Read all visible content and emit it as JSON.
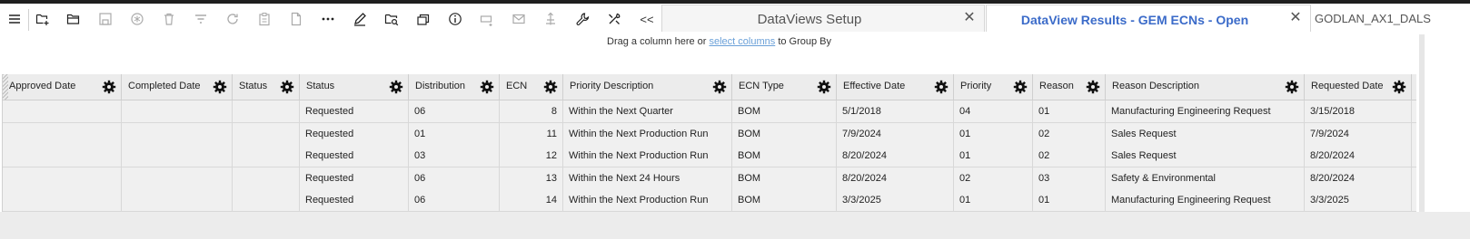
{
  "toolbar": {
    "icons": [
      "menu-icon",
      "add-folder-icon",
      "open-folder-icon",
      "save-icon",
      "settings-asterisk-icon",
      "delete-icon",
      "filter-icon",
      "refresh-icon",
      "clipboard-icon",
      "document-icon",
      "more-icon",
      "edit-icon",
      "search-folder-icon",
      "copy-stack-icon",
      "info-icon",
      "export-icon",
      "mail-icon",
      "hierarchy-icon",
      "wrench-icon",
      "tools-icon"
    ],
    "collapse_label": "<<"
  },
  "tabs": [
    {
      "label": "DataViews Setup",
      "active": false
    },
    {
      "label": "DataView Results - GEM ECNs - Open",
      "active": true
    }
  ],
  "user": "GODLAN_AX1_DALS",
  "groupbar": {
    "prefix": "Drag a column here or ",
    "link": "select columns",
    "suffix": " to Group By"
  },
  "grid": {
    "columns": [
      "Approved Date",
      "Completed Date",
      "Status",
      "Status",
      "Distribution",
      "ECN",
      "Priority Description",
      "ECN Type",
      "Effective Date",
      "Priority",
      "Reason",
      "Reason Description",
      "Requested Date"
    ],
    "rows": [
      [
        "",
        "",
        "",
        "Requested",
        "06",
        "8",
        "Within the Next Quarter",
        "BOM",
        "5/1/2018",
        "04",
        "01",
        "Manufacturing Engineering Request",
        "3/15/2018"
      ],
      [
        "",
        "",
        "",
        "Requested",
        "01",
        "11",
        "Within the Next Production Run",
        "BOM",
        "7/9/2024",
        "01",
        "02",
        "Sales Request",
        "7/9/2024"
      ],
      [
        "",
        "",
        "",
        "Requested",
        "03",
        "12",
        "Within the Next Production Run",
        "BOM",
        "8/20/2024",
        "01",
        "02",
        "Sales Request",
        "8/20/2024"
      ],
      [
        "",
        "",
        "",
        "Requested",
        "06",
        "13",
        "Within the Next 24 Hours",
        "BOM",
        "8/20/2024",
        "02",
        "03",
        "Safety & Environmental",
        "8/20/2024"
      ],
      [
        "",
        "",
        "",
        "Requested",
        "06",
        "14",
        "Within the Next Production Run",
        "BOM",
        "3/3/2025",
        "01",
        "01",
        "Manufacturing Engineering Request",
        "3/3/2025"
      ]
    ]
  },
  "colors": {
    "accent": "#3b6bc9",
    "link": "#6aa0d8",
    "header_bg": "#ececec",
    "row_bg": "#f0f0f0"
  }
}
